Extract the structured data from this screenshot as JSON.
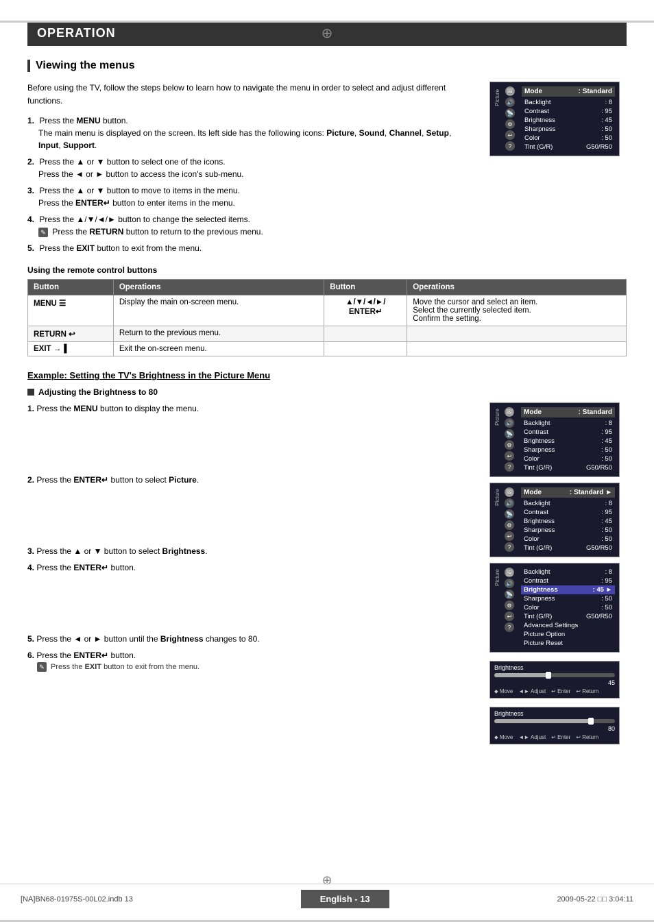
{
  "page": {
    "crosshair": "⊕",
    "operation_header": "OPERATION",
    "section_title": "Viewing the menus",
    "intro_text": "Before using the TV, follow the steps below to learn how to navigate the menu in order to select and adjust different functions.",
    "steps": [
      {
        "num": "1.",
        "text": "Press the ",
        "bold": "MENU",
        "text2": " button.",
        "indent": "The main menu is displayed on the screen. Its left side has the following icons: Picture, Sound, Channel, Setup, Input, Support."
      },
      {
        "num": "2.",
        "text": "Press the ▲ or ▼ button to select one of the icons.",
        "indent": "Press the ◄ or ► button to access the icon's sub-menu."
      },
      {
        "num": "3.",
        "text": "Press the ▲ or ▼ button to move to items in the menu.",
        "indent": "Press the ENTER↵ button to enter items in the menu."
      },
      {
        "num": "4.",
        "text": "Press the ▲/▼/◄/► button to change the selected items.",
        "indent": "Press the RETURN button to return to the previous menu."
      },
      {
        "num": "5.",
        "text": "Press the EXIT button to exit from the menu."
      }
    ],
    "remote_label": "Using the remote control buttons",
    "button_table": {
      "headers": [
        "Button",
        "Operations",
        "Button",
        "Operations"
      ],
      "rows": [
        {
          "btn1": "MENU ☰",
          "ops1": "Display the main on-screen menu.",
          "btn2": "▲/▼/◄/►/\nENTER↵",
          "ops2": "Move the cursor and select an item.\nSelect the currently selected item.\nConfirm the setting."
        },
        {
          "btn1": "RETURN ↩",
          "ops1": "Return to the previous menu.",
          "btn2": "",
          "ops2": ""
        },
        {
          "btn1": "EXIT →▐",
          "ops1": "Exit the on-screen menu.",
          "btn2": "",
          "ops2": ""
        }
      ]
    },
    "example_title": "Example: Setting the TV's Brightness in the Picture Menu",
    "sub_section": "Adjusting the Brightness to 80",
    "example_steps": [
      {
        "num": "1.",
        "text": "Press the ",
        "bold": "MENU",
        "text2": " button to display the menu.",
        "indent": ""
      },
      {
        "num": "2.",
        "text": "Press the ",
        "bold": "ENTER↵",
        "text2": " button to select ",
        "bold2": "Picture",
        "text3": ".",
        "indent": ""
      },
      {
        "num": "3.",
        "text": "Press the ▲ or ▼ button to select ",
        "bold": "Brightness",
        "text2": ".",
        "indent": ""
      },
      {
        "num": "4.",
        "text": "Press the ",
        "bold": "ENTER↵",
        "text2": " button.",
        "indent": ""
      },
      {
        "num": "5.",
        "text": "Press the ◄ or ► button until the ",
        "bold": "Brightness",
        "text2": " changes to 80.",
        "indent": ""
      },
      {
        "num": "6.",
        "text": "Press the ",
        "bold": "ENTER↵",
        "text2": " button.",
        "indent": "Press the EXIT button to exit from the menu."
      }
    ],
    "tv_menu_1": {
      "side_label": "Picture",
      "title": "Mode",
      "title_val": ": Standard",
      "rows": [
        {
          "label": "Backlight",
          "value": ": 8"
        },
        {
          "label": "Contrast",
          "value": ": 95"
        },
        {
          "label": "Brightness",
          "value": ": 45"
        },
        {
          "label": "Sharpness",
          "value": ": 50"
        },
        {
          "label": "Color",
          "value": ": 50"
        },
        {
          "label": "Tint (G/R)",
          "value": "G50/R50"
        }
      ]
    },
    "tv_menu_2": {
      "side_label": "Picture",
      "title": "Mode",
      "title_val": ": Standard ►",
      "rows": [
        {
          "label": "Backlight",
          "value": ": 8"
        },
        {
          "label": "Contrast",
          "value": ": 95"
        },
        {
          "label": "Brightness",
          "value": ": 45"
        },
        {
          "label": "Sharpness",
          "value": ": 50"
        },
        {
          "label": "Color",
          "value": ": 50"
        },
        {
          "label": "Tint (G/R)",
          "value": "G50/R50"
        }
      ]
    },
    "tv_menu_3": {
      "side_label": "Picture",
      "title": "Brightness",
      "title_val": ": 45 ►",
      "rows": [
        {
          "label": "Backlight",
          "value": ": 8"
        },
        {
          "label": "Contrast",
          "value": ": 95"
        },
        {
          "label": "Sharpness",
          "value": ": 50"
        },
        {
          "label": "Color",
          "value": ": 50"
        },
        {
          "label": "Tint (G/R)",
          "value": "G50/R50"
        },
        {
          "label": "Advanced Settings",
          "value": ""
        },
        {
          "label": "Picture Option",
          "value": ""
        },
        {
          "label": "Picture Reset",
          "value": ""
        }
      ],
      "highlighted": "Brightness"
    },
    "brightness_45": {
      "label": "Brightness",
      "value": 45,
      "max": 100,
      "controls": "⬥ Move   ◄► Adjust   ↵ Enter   ↩ Return"
    },
    "brightness_80": {
      "label": "Brightness",
      "value": 80,
      "max": 100,
      "controls": "⬥ Move   ◄► Adjust   ↵ Enter   ↩ Return"
    },
    "footer": {
      "left": "[NA]BN68-01975S-00L02.indb   13",
      "page_label": "English - 13",
      "right": "2009-05-22   □□ 3:04:11"
    }
  }
}
